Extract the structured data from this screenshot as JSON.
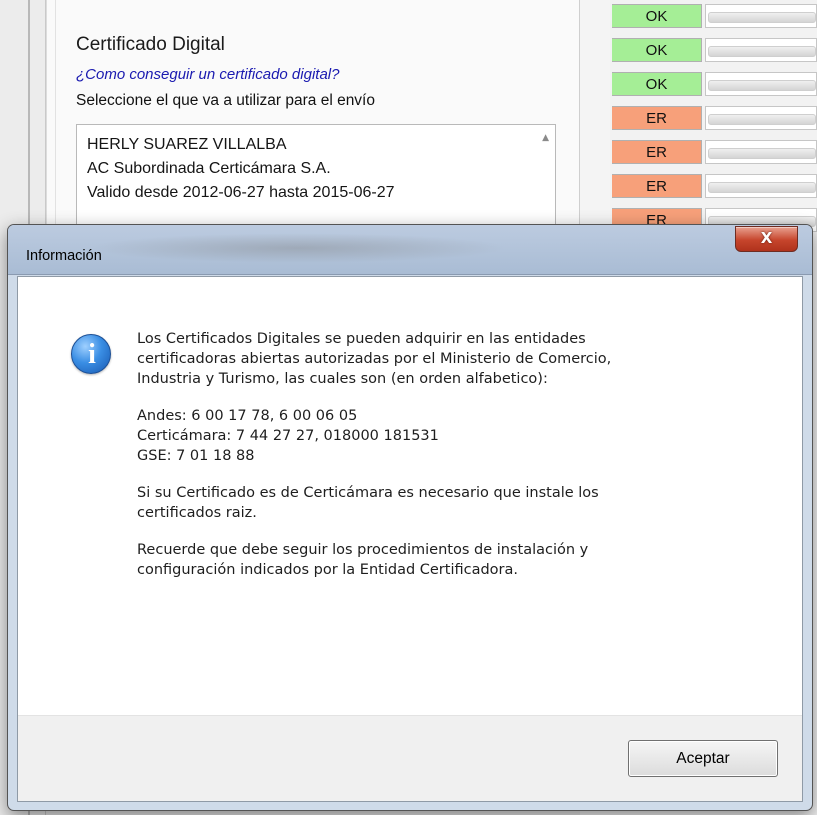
{
  "background": {
    "certificado": {
      "title": "Certificado Digital",
      "link": "¿Como conseguir un certificado digital?",
      "instruction": "Seleccione el que va a utilizar para el envío",
      "selected": {
        "name": "HERLY SUAREZ VILLALBA",
        "issuer": "AC Subordinada Certicámara S.A.",
        "validity": "Valido desde 2012-06-27 hasta 2015-06-27"
      },
      "scroll_up_glyph": "▲"
    },
    "status_cells": [
      "OK",
      "OK",
      "OK",
      "ER",
      "ER",
      "ER",
      "ER"
    ],
    "colors": {
      "ok": "#a5ee96",
      "er": "#f7a07a"
    }
  },
  "dialog": {
    "title": "Información",
    "close_glyph": "X",
    "icon": "info-icon",
    "message": {
      "intro": [
        "Los Certificados Digitales se pueden adquirir en las entidades",
        "certificadoras abiertas autorizadas por el Ministerio de Comercio,",
        "Industria y Turismo, las cuales son (en orden alfabetico):"
      ],
      "entities": [
        "Andes: 6 00 17 78, 6 00 06 05",
        "Certicámara: 7 44 27 27, 018000 181531",
        "GSE: 7 01 18 88"
      ],
      "note": [
        "Si su Certificado es de Certicámara es necesario que instale los",
        "certificados raiz."
      ],
      "reminder": [
        "Recuerde que debe seguir los procedimientos de instalación y",
        "configuración indicados por la Entidad Certificadora."
      ]
    },
    "ok_label": "Aceptar"
  }
}
